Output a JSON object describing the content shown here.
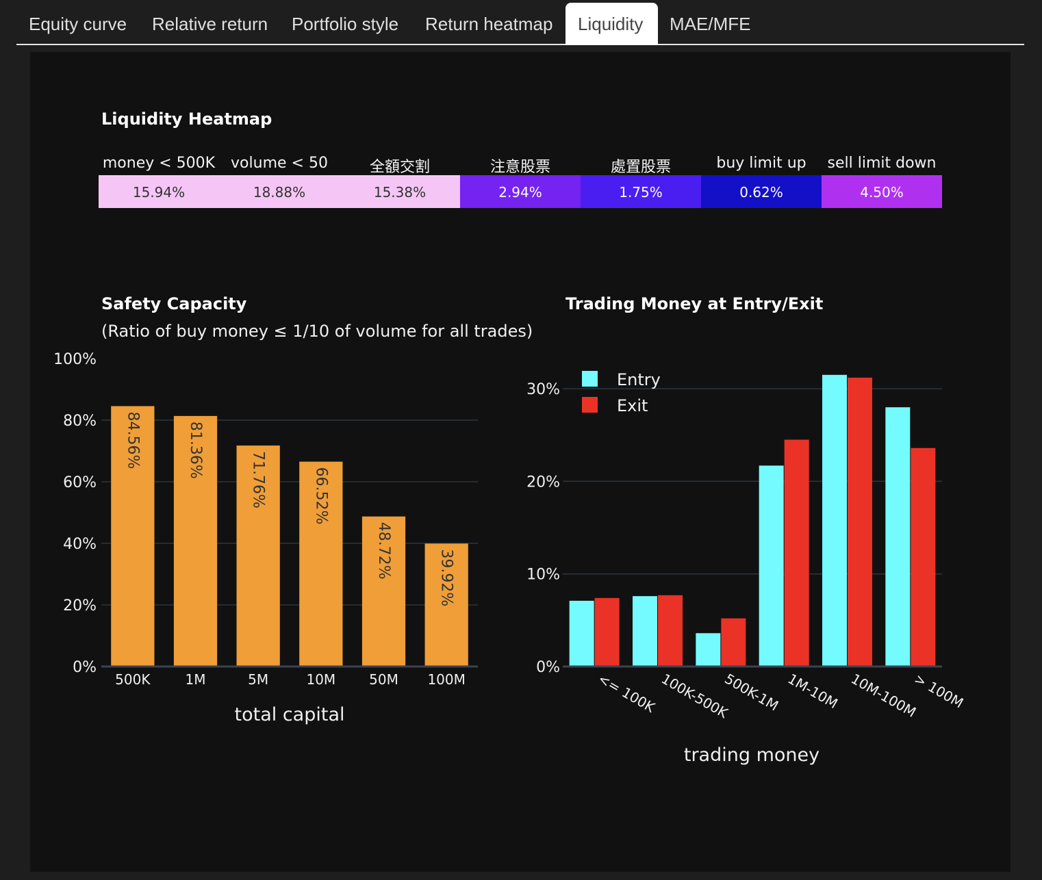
{
  "tabs": [
    {
      "label": "Equity curve",
      "active": false
    },
    {
      "label": "Relative return",
      "active": false
    },
    {
      "label": "Portfolio style",
      "active": false
    },
    {
      "label": "Return heatmap",
      "active": false
    },
    {
      "label": "Liquidity",
      "active": true
    },
    {
      "label": "MAE/MFE",
      "active": false
    }
  ],
  "heatmap": {
    "title": "Liquidity Heatmap",
    "columns": [
      "money < 500K",
      "volume < 50",
      "全額交割",
      "注意股票",
      "處置股票",
      "buy limit up",
      "sell limit down"
    ],
    "values": [
      "15.94%",
      "18.88%",
      "15.38%",
      "2.94%",
      "1.75%",
      "0.62%",
      "4.50%"
    ],
    "colors": [
      "#f5c6f5",
      "#f5c6f5",
      "#f5c6f5",
      "#7423f0",
      "#4a1ef0",
      "#1410c8",
      "#b030f0"
    ],
    "text_colors": [
      "#333333",
      "#333333",
      "#333333",
      "#ffffff",
      "#ffffff",
      "#ffffff",
      "#ffffff"
    ]
  },
  "safety": {
    "title": "Safety Capacity",
    "subtitle": "(Ratio of buy money ≤ 1/10 of volume for all trades)"
  },
  "trading": {
    "title": "Trading Money at Entry/Exit"
  },
  "chart_data": [
    {
      "type": "bar",
      "title": "Safety Capacity",
      "subtitle": "(Ratio of buy money ≤ 1/10 of volume for all trades)",
      "categories": [
        "500K",
        "1M",
        "5M",
        "10M",
        "50M",
        "100M"
      ],
      "values": [
        84.56,
        81.36,
        71.76,
        66.52,
        48.72,
        39.92
      ],
      "labels": [
        "84.56%",
        "81.36%",
        "71.76%",
        "66.52%",
        "48.72%",
        "39.92%"
      ],
      "xlabel": "total capital",
      "ylabel": "",
      "ylim": [
        0,
        100
      ],
      "yticks": [
        "0%",
        "20%",
        "40%",
        "60%",
        "80%",
        "100%"
      ],
      "color": "#f09e38",
      "grid": true
    },
    {
      "type": "bar",
      "title": "Trading Money at Entry/Exit",
      "categories": [
        "<= 100K",
        "100K-500K",
        "500K-1M",
        "1M-10M",
        "10M-100M",
        "> 100M"
      ],
      "series": [
        {
          "name": "Entry",
          "color": "#74fbff",
          "values": [
            7.1,
            7.6,
            3.6,
            21.7,
            31.5,
            28.0
          ]
        },
        {
          "name": "Exit",
          "color": "#ea3326",
          "values": [
            7.4,
            7.7,
            5.2,
            24.5,
            31.2,
            23.6
          ]
        }
      ],
      "xlabel": "trading money",
      "ylabel": "",
      "ylim": [
        0,
        32.5
      ],
      "yticks": [
        "0%",
        "10%",
        "20%",
        "30%"
      ],
      "legend": "top-left",
      "grid": true
    }
  ]
}
